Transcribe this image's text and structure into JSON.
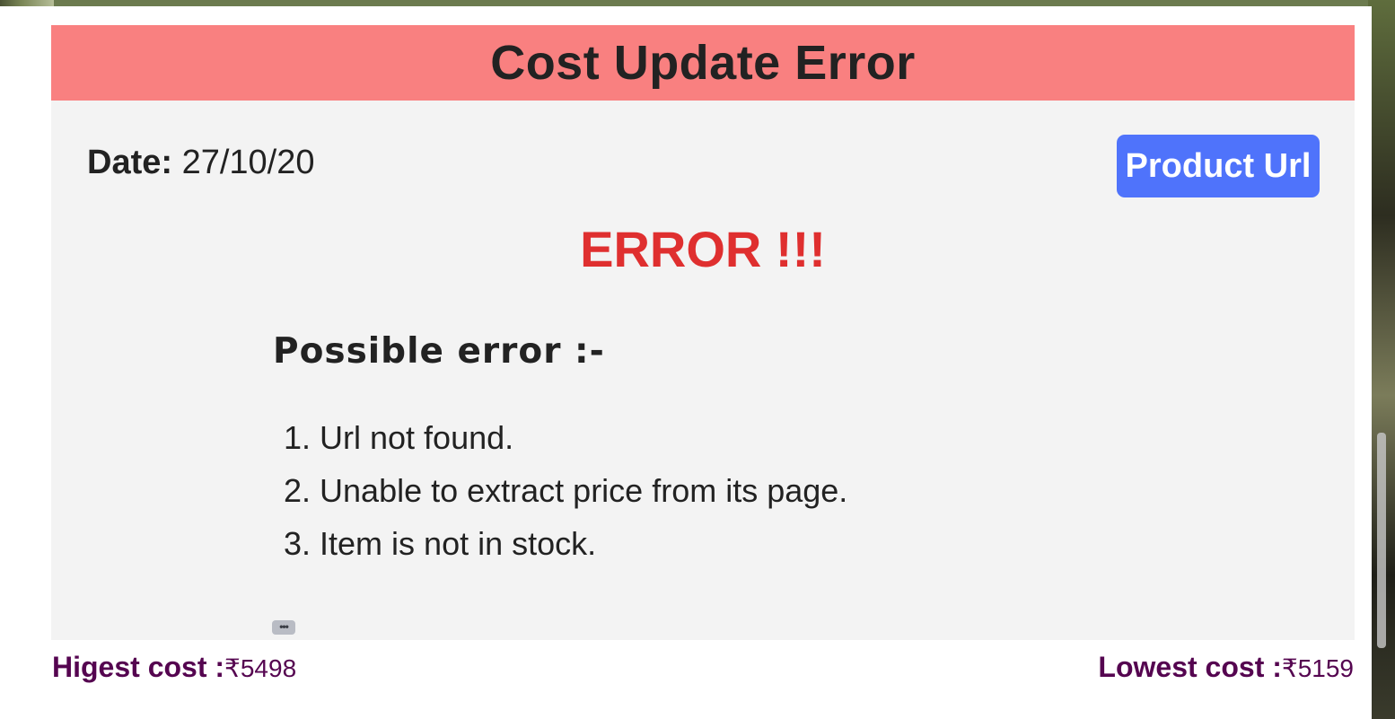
{
  "header": {
    "title": "Cost Update Error"
  },
  "details": {
    "date_label": "Date:",
    "date_value": "27/10/20",
    "product_url_label": "Product Url"
  },
  "error": {
    "title": "ERROR !!!",
    "possible_label": "Possible error :-",
    "reasons": [
      "1. Url not found.",
      "2. Unable to extract price from its page.",
      "3. Item is not in stock."
    ],
    "more_label": "•••"
  },
  "footer": {
    "highest_label": "Higest cost :",
    "highest_value": "₹5498",
    "lowest_label": "Lowest cost :",
    "lowest_value": "₹5159"
  }
}
